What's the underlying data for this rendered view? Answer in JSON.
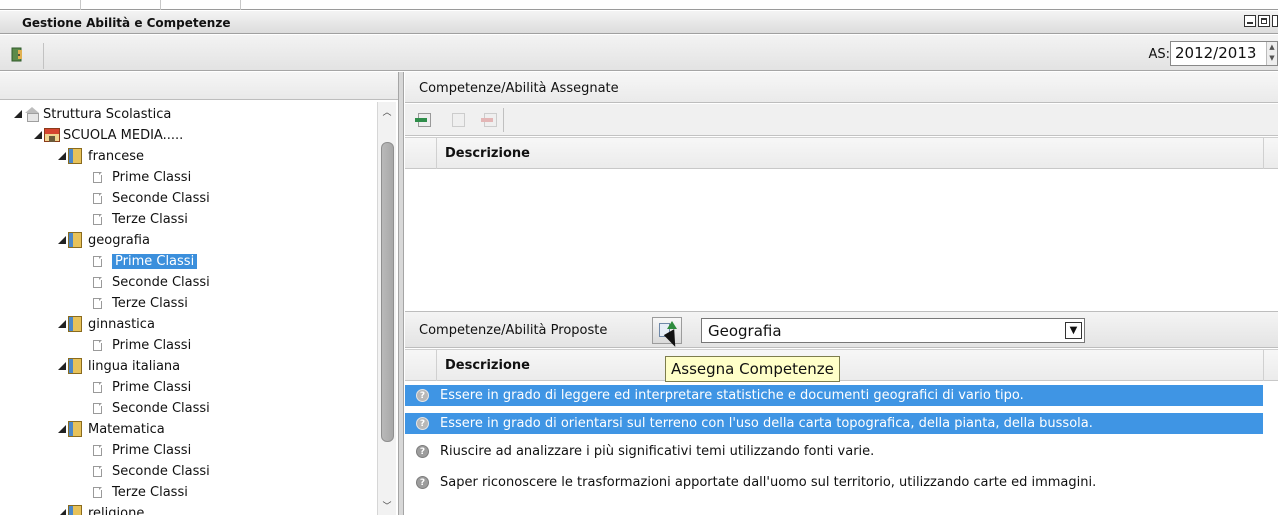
{
  "window": {
    "title": "Gestione Abilità e Competenze",
    "controls": [
      "minimize-icon",
      "maximize-icon",
      "close-icon"
    ]
  },
  "toolbar": {
    "as_label": "AS:",
    "as_value": "2012/2013"
  },
  "tree": {
    "nodes": [
      {
        "label": "Struttura Scolastica",
        "type": "root"
      },
      {
        "label": "SCUOLA MEDIA.....",
        "type": "school"
      },
      {
        "label": "francese",
        "type": "subject"
      },
      {
        "label": "Prime Classi",
        "type": "class"
      },
      {
        "label": "Seconde Classi",
        "type": "class"
      },
      {
        "label": "Terze Classi",
        "type": "class"
      },
      {
        "label": "geografia",
        "type": "subject"
      },
      {
        "label": "Prime Classi",
        "type": "class",
        "selected": true
      },
      {
        "label": "Seconde Classi",
        "type": "class"
      },
      {
        "label": "Terze Classi",
        "type": "class"
      },
      {
        "label": "ginnastica",
        "type": "subject"
      },
      {
        "label": "Prime Classi",
        "type": "class"
      },
      {
        "label": "lingua italiana",
        "type": "subject"
      },
      {
        "label": "Prime Classi",
        "type": "class"
      },
      {
        "label": "Seconde Classi",
        "type": "class"
      },
      {
        "label": "Matematica",
        "type": "subject"
      },
      {
        "label": "Prime Classi",
        "type": "class"
      },
      {
        "label": "Seconde Classi",
        "type": "class"
      },
      {
        "label": "Terze Classi",
        "type": "class"
      },
      {
        "label": "religione",
        "type": "subject"
      }
    ]
  },
  "assigned": {
    "header": "Competenze/Abilità Assegnate",
    "column": "Descrizione"
  },
  "proposed": {
    "header": "Competenze/Abilità Proposte",
    "subject_select": "Geografia",
    "column": "Descrizione",
    "tooltip": "Assegna Competenze",
    "rows": [
      {
        "text": "Essere in grado di leggere ed interpretare statistiche e documenti geografici di vario tipo.",
        "selected": true
      },
      {
        "text": "Essere in grado di orientarsi sul terreno con l'uso della carta topografica, della pianta, della bussola.",
        "selected": true
      },
      {
        "text": "Riuscire ad analizzare i più significativi temi utilizzando fonti varie.",
        "selected": false
      },
      {
        "text": "Saper riconoscere le trasformazioni apportate dall'uomo sul territorio, utilizzando carte ed immagini.",
        "selected": false
      }
    ]
  },
  "colors": {
    "selection": "#3f95e4",
    "tooltip_bg": "#ffffc8"
  }
}
